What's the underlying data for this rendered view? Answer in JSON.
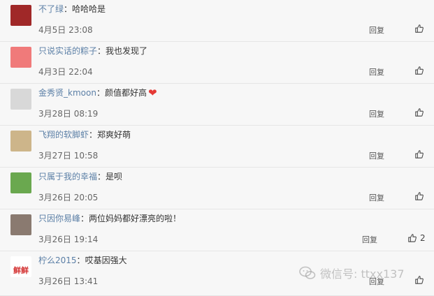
{
  "reply_label": "回复",
  "comments": [
    {
      "author": "不了绿",
      "text": "哈哈哈是",
      "time": "4月5日 23:08",
      "likes": "",
      "emoji": "",
      "avatar_color": "#a02828"
    },
    {
      "author": "只说实话的粽子",
      "text": "我也发现了",
      "time": "4月3日 22:04",
      "likes": "",
      "emoji": "",
      "avatar_color": "#f07a7a"
    },
    {
      "author": "金秀贤_kmoon",
      "text": "颜值都好高",
      "time": "3月28日 08:19",
      "likes": "",
      "emoji": "❤",
      "avatar_color": "#d8d8d8"
    },
    {
      "author": "飞翔的软脚虾",
      "text": "郑爽好萌",
      "time": "3月27日 10:58",
      "likes": "",
      "emoji": "",
      "avatar_color": "#cdb58a"
    },
    {
      "author": "只属于我的幸福",
      "text": "是呗",
      "time": "3月26日 20:05",
      "likes": "",
      "emoji": "",
      "avatar_color": "#6aa84f"
    },
    {
      "author": "只因你易峰",
      "text": "两位妈妈都好漂亮的啦！",
      "time": "3月26日 19:14",
      "likes": "2",
      "emoji": "",
      "avatar_color": "#8a7a70"
    },
    {
      "author": "柠么2015",
      "text": "哎基因强大",
      "time": "3月26日 13:41",
      "likes": "",
      "emoji": "",
      "avatar_color": "#d32f2f",
      "avatar_text": "鲜鲜"
    }
  ],
  "watermark": {
    "text": "微信号: ttxx137"
  }
}
